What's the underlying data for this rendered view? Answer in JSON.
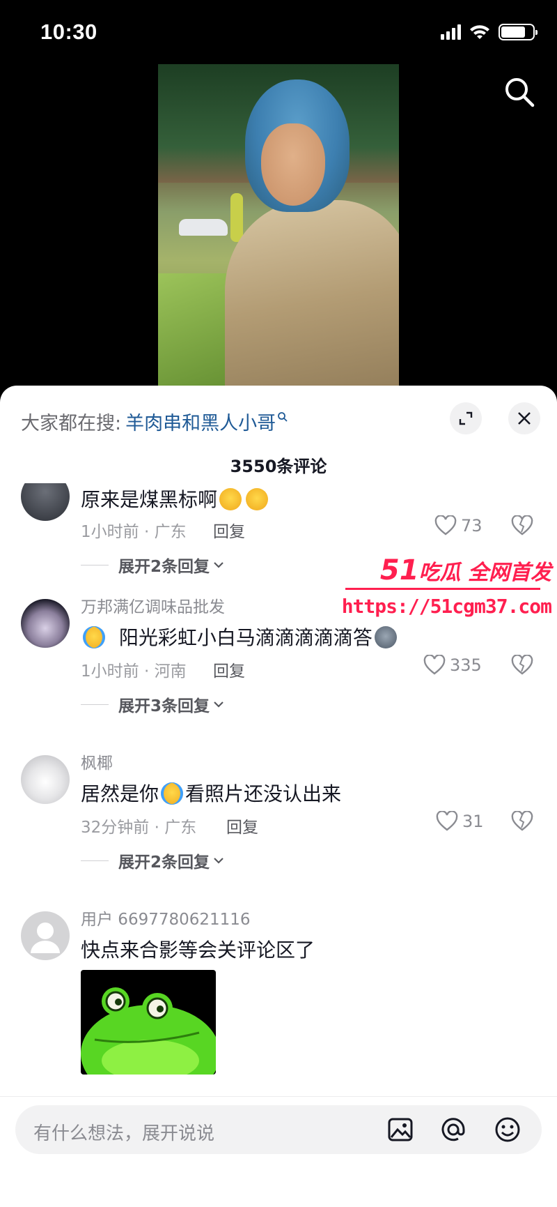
{
  "status_bar": {
    "time": "10:30"
  },
  "hot_search": {
    "prefix": "大家都在搜:",
    "keyword": "羊肉串和黑人小哥"
  },
  "comment_count": "3550条评论",
  "comments": [
    {
      "name": "",
      "text": "原来是煤黑标啊",
      "emojis": [
        "smirk",
        "smirk"
      ],
      "time": "1小时前",
      "location": "广东",
      "reply": "回复",
      "likes": "73",
      "expand": "展开2条回复"
    },
    {
      "name": "万邦满亿调味品批发",
      "text": "阳光彩虹小白马滴滴滴滴滴答",
      "lead_emoji": "cry",
      "trail_emoji": "wolf",
      "time": "1小时前",
      "location": "河南",
      "reply": "回复",
      "likes": "335",
      "expand": "展开3条回复"
    },
    {
      "name": "枫椰",
      "text_before": "居然是你",
      "text_after": "看照片还没认出来",
      "mid_emoji": "cry",
      "time": "32分钟前",
      "location": "广东",
      "reply": "回复",
      "likes": "31",
      "expand": "展开2条回复"
    },
    {
      "name": "用户 6697780621116",
      "text": "快点来合影等会关评论区了"
    }
  ],
  "watermark": {
    "brand_num": "51",
    "brand_text": "吃瓜 全网首发",
    "url": "https://51cgm37.com"
  },
  "input": {
    "placeholder": "有什么想法，展开说说"
  },
  "icons": {
    "search": "search-icon",
    "expand": "expand-icon",
    "close": "close-icon",
    "heart": "heart-icon",
    "dislike": "broken-heart-icon",
    "image": "image-icon",
    "mention": "at-icon",
    "emoji": "emoji-icon"
  },
  "colors": {
    "keyword": "#1f5a96",
    "watermark": "#ff1f4f"
  }
}
